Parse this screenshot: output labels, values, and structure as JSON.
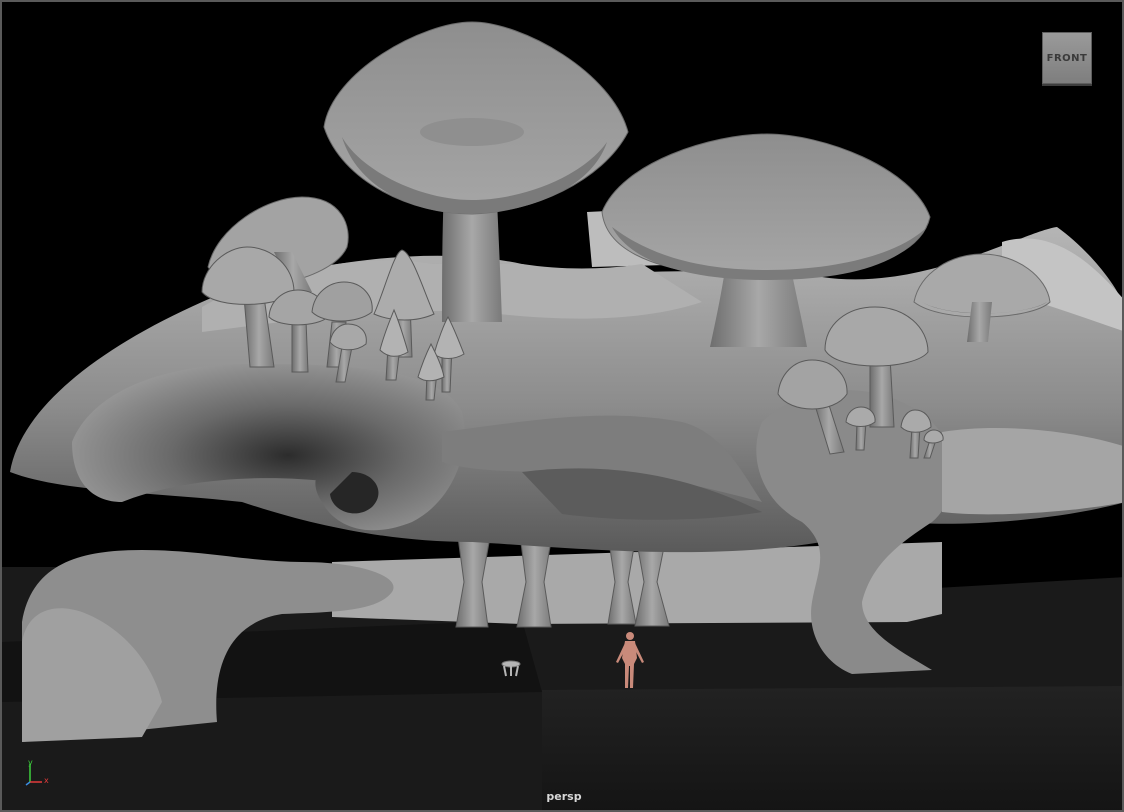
{
  "viewport": {
    "camera_name": "persp",
    "view_cube_label": "FRONT",
    "axis_labels": {
      "y": "y",
      "x": "x"
    }
  },
  "colors": {
    "background": "#000000",
    "ground": "#1b1b1b",
    "mesh_light": "#b9b9b9",
    "mesh_mid": "#8a8a8a",
    "mesh_dark": "#4a4a4a",
    "figure": "#c98a7a",
    "axis_x": "#e23a3a",
    "axis_y": "#3ccf3c",
    "axis_z": "#3a8de2"
  }
}
